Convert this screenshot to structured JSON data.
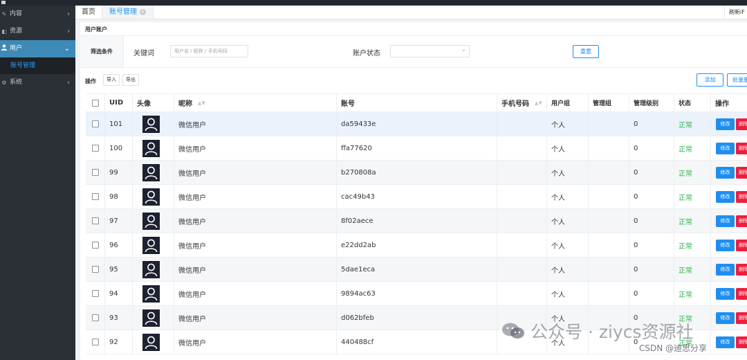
{
  "sidebar": {
    "items": [
      {
        "label": "内容",
        "icon": "document-icon"
      },
      {
        "label": "资源",
        "icon": "database-icon"
      },
      {
        "label": "用户",
        "icon": "user-icon",
        "active": true
      },
      {
        "label": "系统",
        "icon": "gear-icon"
      }
    ],
    "sub_item": "账号管理"
  },
  "tabs": {
    "home": "首页",
    "account": "账号管理",
    "refresh": "刷新iF"
  },
  "page": {
    "title": "用户账户"
  },
  "filter": {
    "label": "筛选条件",
    "keyword_label": "关键词",
    "keyword_placeholder": "用户名 / 昵称 / 手机号码",
    "keyword_value": "",
    "status_label": "账户状态",
    "status_value": "",
    "reset": "重置"
  },
  "ops": {
    "label": "操作",
    "import": "导入",
    "export": "导出",
    "add": "添加",
    "batch": "批量删除"
  },
  "table": {
    "headers": {
      "uid": "UID",
      "avatar": "头像",
      "nickname": "昵称",
      "account": "账号",
      "phone": "手机号码",
      "user_group": "用户组",
      "manage_group": "管理组",
      "manage_level": "管理级别",
      "status": "状态",
      "op": "操作"
    },
    "edit_label": "修改",
    "delete_label": "删除",
    "rows": [
      {
        "uid": "101",
        "nickname": "微信用户",
        "account": "da59433e",
        "phone": "",
        "user_group": "个人",
        "manage_group": "",
        "manage_level": "0",
        "status": "正常"
      },
      {
        "uid": "100",
        "nickname": "微信用户",
        "account": "ffa77620",
        "phone": "",
        "user_group": "个人",
        "manage_group": "",
        "manage_level": "0",
        "status": "正常"
      },
      {
        "uid": "99",
        "nickname": "微信用户",
        "account": "b270808a",
        "phone": "",
        "user_group": "个人",
        "manage_group": "",
        "manage_level": "0",
        "status": "正常"
      },
      {
        "uid": "98",
        "nickname": "微信用户",
        "account": "cac49b43",
        "phone": "",
        "user_group": "个人",
        "manage_group": "",
        "manage_level": "0",
        "status": "正常"
      },
      {
        "uid": "97",
        "nickname": "微信用户",
        "account": "8f02aece",
        "phone": "",
        "user_group": "个人",
        "manage_group": "",
        "manage_level": "0",
        "status": "正常"
      },
      {
        "uid": "96",
        "nickname": "微信用户",
        "account": "e22dd2ab",
        "phone": "",
        "user_group": "个人",
        "manage_group": "",
        "manage_level": "0",
        "status": "正常"
      },
      {
        "uid": "95",
        "nickname": "微信用户",
        "account": "5dae1eca",
        "phone": "",
        "user_group": "个人",
        "manage_group": "",
        "manage_level": "0",
        "status": "正常"
      },
      {
        "uid": "94",
        "nickname": "微信用户",
        "account": "9894ac63",
        "phone": "",
        "user_group": "个人",
        "manage_group": "",
        "manage_level": "0",
        "status": "正常"
      },
      {
        "uid": "93",
        "nickname": "微信用户",
        "account": "d062bfeb",
        "phone": "",
        "user_group": "个人",
        "manage_group": "",
        "manage_level": "0",
        "status": "正常"
      },
      {
        "uid": "92",
        "nickname": "微信用户",
        "account": "440488cf",
        "phone": "",
        "user_group": "个人",
        "manage_group": "",
        "manage_level": "0",
        "status": "正常"
      }
    ]
  },
  "watermark": {
    "main": "公众号 · ziycs资源社",
    "sub": "CSDN @迪思分享"
  },
  "colors": {
    "accent": "#1e8ff0",
    "danger": "#f01d3c",
    "success": "#2fb24a",
    "sidebar_bg": "#2b2f36",
    "sidebar_active": "#3e8ab7"
  }
}
